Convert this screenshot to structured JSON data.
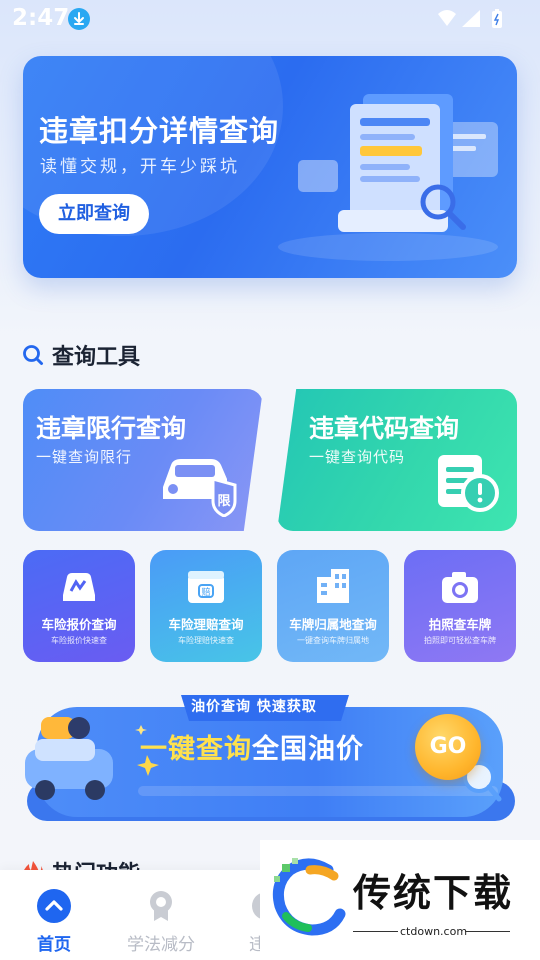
{
  "status_bar": {
    "time": "2:47"
  },
  "banner": {
    "title": "违章扣分详情查询",
    "subtitle": "读懂交规，开车少踩坑",
    "button": "立即查询"
  },
  "tools_section": {
    "title": "查询工具"
  },
  "big_cards": [
    {
      "title": "违章限行查询",
      "subtitle": "一键查询限行",
      "badge": "限"
    },
    {
      "title": "违章代码查询",
      "subtitle": "一键查询代码"
    }
  ],
  "tiles": [
    {
      "title": "车险报价查询",
      "subtitle": "车险报价快速查"
    },
    {
      "title": "车险理赔查询",
      "subtitle": "车险理赔快速查"
    },
    {
      "title": "车牌归属地查询",
      "subtitle": "一键查询车牌归属地"
    },
    {
      "title": "拍照查车牌",
      "subtitle": "拍照即可轻松查车牌"
    }
  ],
  "oil_banner": {
    "tag": "油价查询  快速获取",
    "highlight": "一键查询",
    "main": "全国油价",
    "go": "GO"
  },
  "hot_section": {
    "title": "热门功能"
  },
  "bottom_nav": [
    {
      "label": "首页"
    },
    {
      "label": "学法减分"
    },
    {
      "label": "违章"
    }
  ],
  "watermark": {
    "brand": "传统下载",
    "url": "ctdown.com"
  },
  "colors": {
    "primary": "#1f66f0",
    "teal": "#2fd3ae",
    "orange": "#ffb62d"
  }
}
